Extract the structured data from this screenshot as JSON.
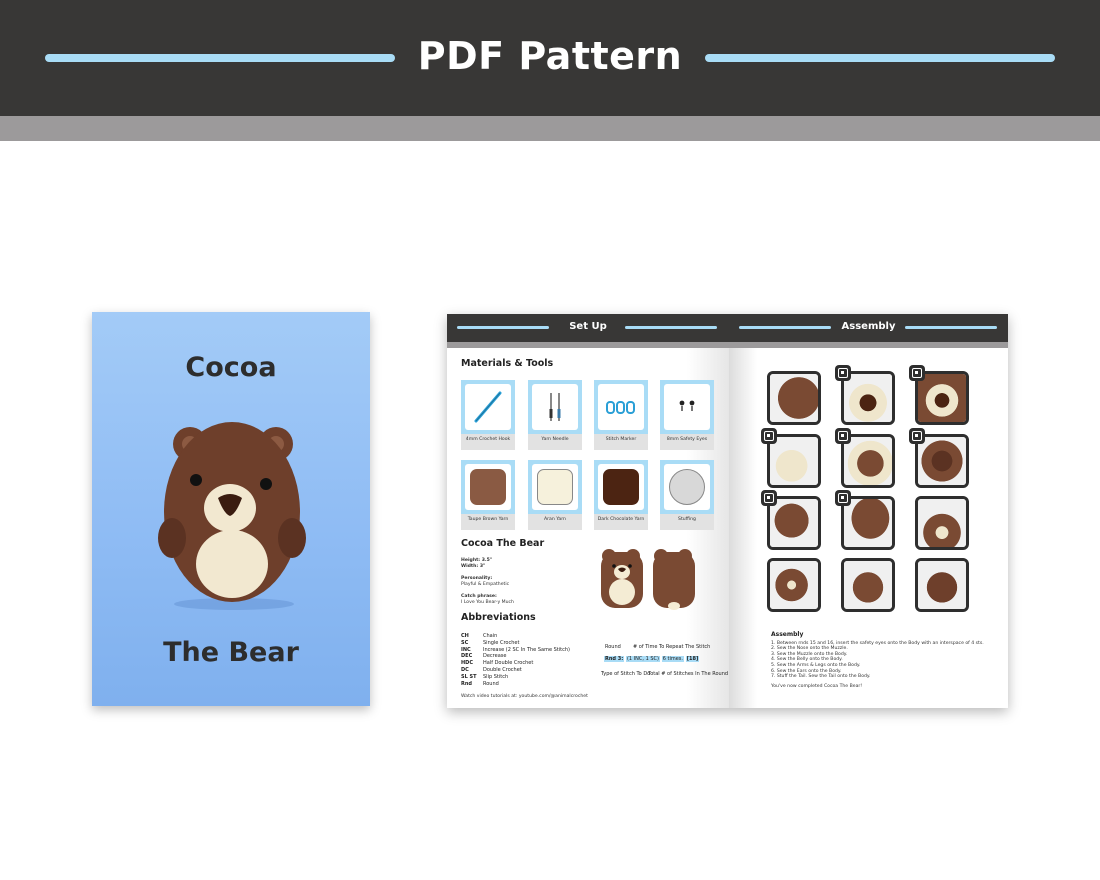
{
  "banner": {
    "title": "PDF Pattern"
  },
  "cover": {
    "line1": "Cocoa",
    "line2": "The Bear"
  },
  "left_page": {
    "header": "Set Up",
    "materials_title": "Materials & Tools",
    "tools": [
      {
        "label": "4mm Crochet Hook"
      },
      {
        "label": "Yarn Needle"
      },
      {
        "label": "Stitch Marker"
      },
      {
        "label": "8mm Safety Eyes"
      }
    ],
    "yarns": [
      {
        "label": "Taupe Brown Yarn",
        "color": "#8a5a43"
      },
      {
        "label": "Aran Yarn",
        "color": "#f6f1dc"
      },
      {
        "label": "Dark Chocolate Yarn",
        "color": "#4c2412"
      },
      {
        "label": "Stuffing",
        "color": "#d8d8d8"
      }
    ],
    "character_title": "Cocoa The Bear",
    "height": "Height: 3.5\"",
    "width": "Width: 3\"",
    "personality_label": "Personality:",
    "personality": "Playful & Empathetic",
    "catch_label": "Catch phrase:",
    "catch": "I Love You Bear-y Much",
    "abbr_title": "Abbreviations",
    "abbreviations": [
      {
        "k": "CH",
        "v": "Chain"
      },
      {
        "k": "SC",
        "v": "Single Crochet"
      },
      {
        "k": "INC",
        "v": "Increase (2 SC In The Same Stitch)"
      },
      {
        "k": "DEC",
        "v": "Decrease"
      },
      {
        "k": "HDC",
        "v": "Half Double Crochet"
      },
      {
        "k": "DC",
        "v": "Double Crochet"
      },
      {
        "k": "SL ST",
        "v": "Slip Stitch"
      },
      {
        "k": "Rnd",
        "v": "Round"
      }
    ],
    "diagram": {
      "round_label": "Round",
      "repeat_label": "# of Time To Repeat The Stitch",
      "rnd": "Rnd 3:",
      "stitch": "(1 INC, 1 SC)",
      "times": "6 times.",
      "total": "[18]",
      "type_label": "Type of Stitch To Do",
      "total_label": "Total # of Stitches In The Round"
    },
    "footer": "Watch video tutorials at: youtube.com/@animalcrochet"
  },
  "right_page": {
    "header": "Assembly",
    "assembly_title": "Assembly",
    "steps": [
      "1. Between rnds 15 and 16, insert the safety eyes onto the Body with an interspace of 4 sts.",
      "2. Sew the Nose onto the Muzzle.",
      "3. Sew the Muzzle onto the Body.",
      "4. Sew the Belly onto the Body.",
      "5. Sew the Arms & Legs onto the Body.",
      "6. Sew the Ears onto the Body.",
      "7. Stuff the Tail. Sew the Tail onto the Body."
    ],
    "closing": "You've now completed Cocoa The Bear!"
  },
  "colors": {
    "dark": "#383736",
    "accent": "#a9dcf6",
    "band": "#9c9a9b",
    "cover_bg": "#8fbcf4",
    "bear_brown": "#6e3f2b"
  }
}
